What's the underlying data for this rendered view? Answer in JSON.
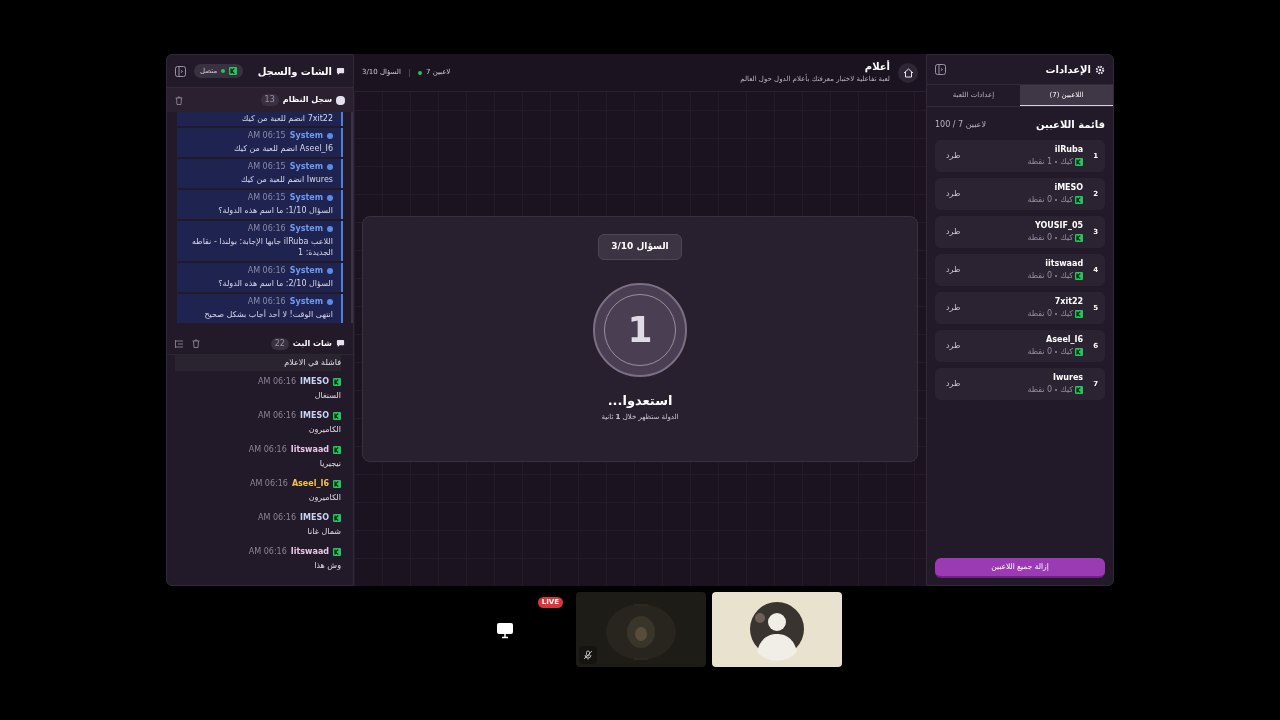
{
  "chat_panel": {
    "title": "الشات والسجل",
    "status": "متصل",
    "connected": true,
    "system_log": {
      "title": "سجل النظام",
      "count": "13",
      "entries": [
        {
          "kind": "partial",
          "text": "7xit22 انضم للعبة من كيك"
        },
        {
          "kind": "full",
          "sender": "System",
          "time": "AM 06:15",
          "text": "Aseel_I6 انضم للعبة من كيك"
        },
        {
          "kind": "full",
          "sender": "System",
          "time": "AM 06:15",
          "text": "Iwures انضم للعبة من كيك"
        },
        {
          "kind": "full",
          "sender": "System",
          "time": "AM 06:15",
          "text": "السؤال 1/10: ما اسم هذه الدولة؟"
        },
        {
          "kind": "full",
          "sender": "System",
          "time": "AM 06:16",
          "text": "اللاعب ilRuba جابها الإجابة: بولندا - نقاطه الجديدة: 1"
        },
        {
          "kind": "full",
          "sender": "System",
          "time": "AM 06:16",
          "text": "السؤال 2/10: ما اسم هذه الدولة؟"
        },
        {
          "kind": "full",
          "sender": "System",
          "time": "AM 06:16",
          "text": "انتهى الوقت! لا أحد أجاب بشكل صحيح"
        }
      ]
    },
    "stream_chat": {
      "title": "شات البث",
      "count": "22",
      "messages": [
        {
          "kind": "partial",
          "text": "فاشلة في الاعلام"
        },
        {
          "kind": "full",
          "user": "IMESO",
          "time": "AM 06:16",
          "text": "السنغال",
          "color": "#c9d3f5"
        },
        {
          "kind": "full",
          "user": "IMESO",
          "time": "AM 06:16",
          "text": "الكاميرون",
          "color": "#c9d3f5"
        },
        {
          "kind": "full",
          "user": "Iitswaad",
          "time": "AM 06:16",
          "text": "نيجيريا",
          "color": "#e8c6e8"
        },
        {
          "kind": "full",
          "user": "Aseel_I6",
          "time": "AM 06:16",
          "text": "الكاميرون",
          "color": "#f2c14e"
        },
        {
          "kind": "full",
          "user": "IMESO",
          "time": "AM 06:16",
          "text": "شمال غانا",
          "color": "#c9d3f5"
        },
        {
          "kind": "full",
          "user": "Iitswaad",
          "time": "AM 06:16",
          "text": "وش هذا",
          "color": "#e8c6e8"
        }
      ]
    }
  },
  "header": {
    "title": "أعلام",
    "subtitle": "لعبة تفاعلية لاختبار معرفتك بأعلام الدول حول العالم",
    "players": "7 لاعبين",
    "question": "السؤال 3/10"
  },
  "stage": {
    "question_badge": "السؤال 3/10",
    "countdown": "1",
    "heading": "استعدوا...",
    "note": "الدولة ستظهر خلال **1** ثانية"
  },
  "settings_panel": {
    "title": "الإعدادات",
    "tabs": [
      {
        "label": "اللاعبين (7)",
        "selected": true
      },
      {
        "label": "إعدادات اللعبة",
        "selected": false
      }
    ],
    "list_title": "قائمة اللاعبين",
    "capacity": "100 / 7 لاعبين",
    "players": [
      {
        "rank": "1",
        "name": "ilRuba",
        "platform": "كيك",
        "points": "1 نقطة",
        "action": "طرد"
      },
      {
        "rank": "2",
        "name": "iMESO",
        "platform": "كيك",
        "points": "0 نقطة",
        "action": "طرد"
      },
      {
        "rank": "3",
        "name": "YOUSIF_05",
        "platform": "كيك",
        "points": "0 نقطة",
        "action": "طرد"
      },
      {
        "rank": "4",
        "name": "iitswaad",
        "platform": "كيك",
        "points": "0 نقطة",
        "action": "طرد"
      },
      {
        "rank": "5",
        "name": "7xit22",
        "platform": "كيك",
        "points": "0 نقطة",
        "action": "طرد"
      },
      {
        "rank": "6",
        "name": "Aseel_I6",
        "platform": "كيك",
        "points": "0 نقطة",
        "action": "طرد"
      },
      {
        "rank": "7",
        "name": "Iwures",
        "platform": "كيك",
        "points": "0 نقطة",
        "action": "طرد"
      }
    ],
    "clear_button": "إزالة جميع اللاعبين"
  },
  "streams": [
    {
      "kind": "screen",
      "badge": "LIVE"
    },
    {
      "kind": "camera"
    },
    {
      "kind": "avatar"
    }
  ]
}
